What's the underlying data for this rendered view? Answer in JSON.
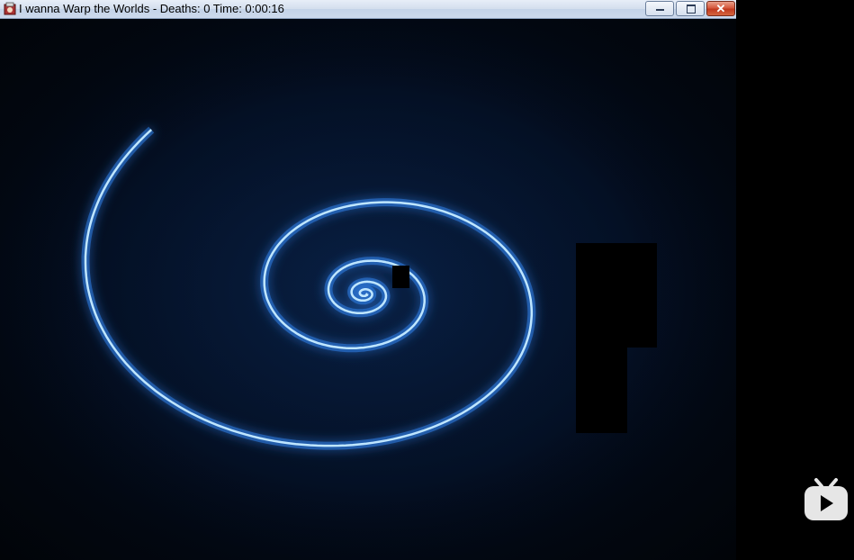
{
  "window": {
    "title": "I wanna Warp the Worlds - Deaths: 0 Time: 0:00:16",
    "controls": {
      "minimize": "minimize",
      "maximize": "maximize",
      "close": "✕"
    }
  },
  "game": {
    "deaths": 0,
    "time": "0:00:16"
  },
  "colors": {
    "spiral": "#bfe6ff",
    "glow": "#2f7fe8",
    "background": "#030a18"
  },
  "overlay": {
    "icon": "bilibili-tv-icon"
  }
}
